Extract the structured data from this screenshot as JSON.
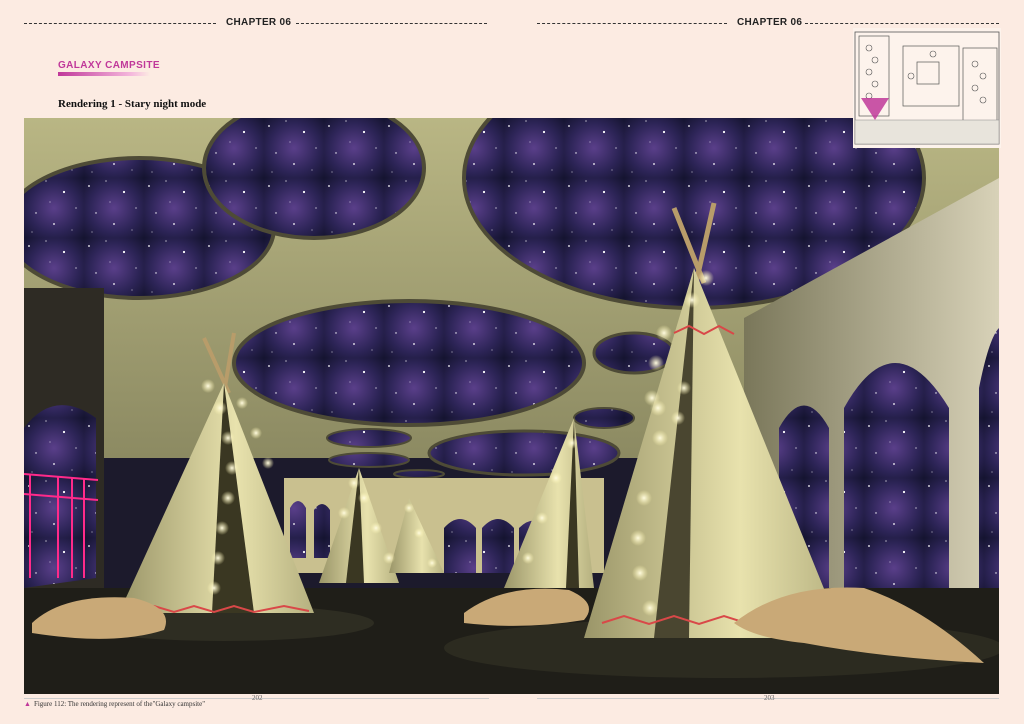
{
  "header": {
    "left_chapter": "CHAPTER 06",
    "right_chapter": "CHAPTER 06"
  },
  "section": {
    "title": "GALAXY CAMPSITE",
    "rendering_caption": "Rendering 1 - Stary night mode"
  },
  "figure": {
    "note": "Figure 112:  The rendering represent of the\"Galaxy campsite\""
  },
  "pages": {
    "left": "202",
    "right": "203"
  },
  "colors": {
    "background": "#fcebe2",
    "accent": "#c0389a",
    "sky": "#2a2250",
    "canopy": "#c9c79b",
    "tent": "#ddd8a4"
  }
}
